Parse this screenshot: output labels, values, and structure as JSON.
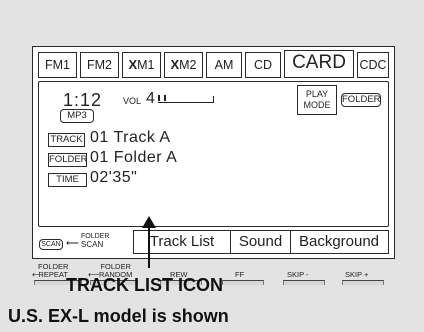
{
  "source_tabs": [
    {
      "label": "FM1"
    },
    {
      "label": "FM2"
    },
    {
      "prefix": "X",
      "label": "M1"
    },
    {
      "prefix": "X",
      "label": "M2"
    },
    {
      "label": "AM"
    },
    {
      "label": "CD"
    },
    {
      "label": "CARD",
      "selected": true
    },
    {
      "label": "CDC"
    }
  ],
  "display": {
    "time": "1:12",
    "vol_label": "VOL",
    "vol_value": "4",
    "format_badge": "MP3",
    "play_mode": [
      "PLAY",
      "MODE"
    ],
    "folder_button": "FOLDER",
    "track_tag": "TRACK",
    "track_line": "01  Track A",
    "folder_tag": "FOLDER",
    "folder_line": "01  Folder A",
    "time_tag": "TIME",
    "time_line": "02'35\""
  },
  "scan": {
    "scan_label": "SCAN",
    "folder_scan_top": "FOLDER",
    "folder_scan_bottom": "SCAN"
  },
  "bottom_bar": [
    "Track List",
    "Sound",
    "Background"
  ],
  "hardware_buttons": [
    {
      "top": "FOLDER",
      "bottom": "REPEAT"
    },
    {
      "top": "FOLDER",
      "bottom": "RANDOM"
    },
    {
      "top": "",
      "bottom": "REW"
    },
    {
      "top": "",
      "bottom": "FF"
    },
    {
      "top": "",
      "bottom": "SKIP -"
    },
    {
      "top": "",
      "bottom": "SKIP +"
    }
  ],
  "captions": {
    "callout": "TRACK LIST ICON",
    "model_note": "U.S. EX-L model is shown"
  }
}
